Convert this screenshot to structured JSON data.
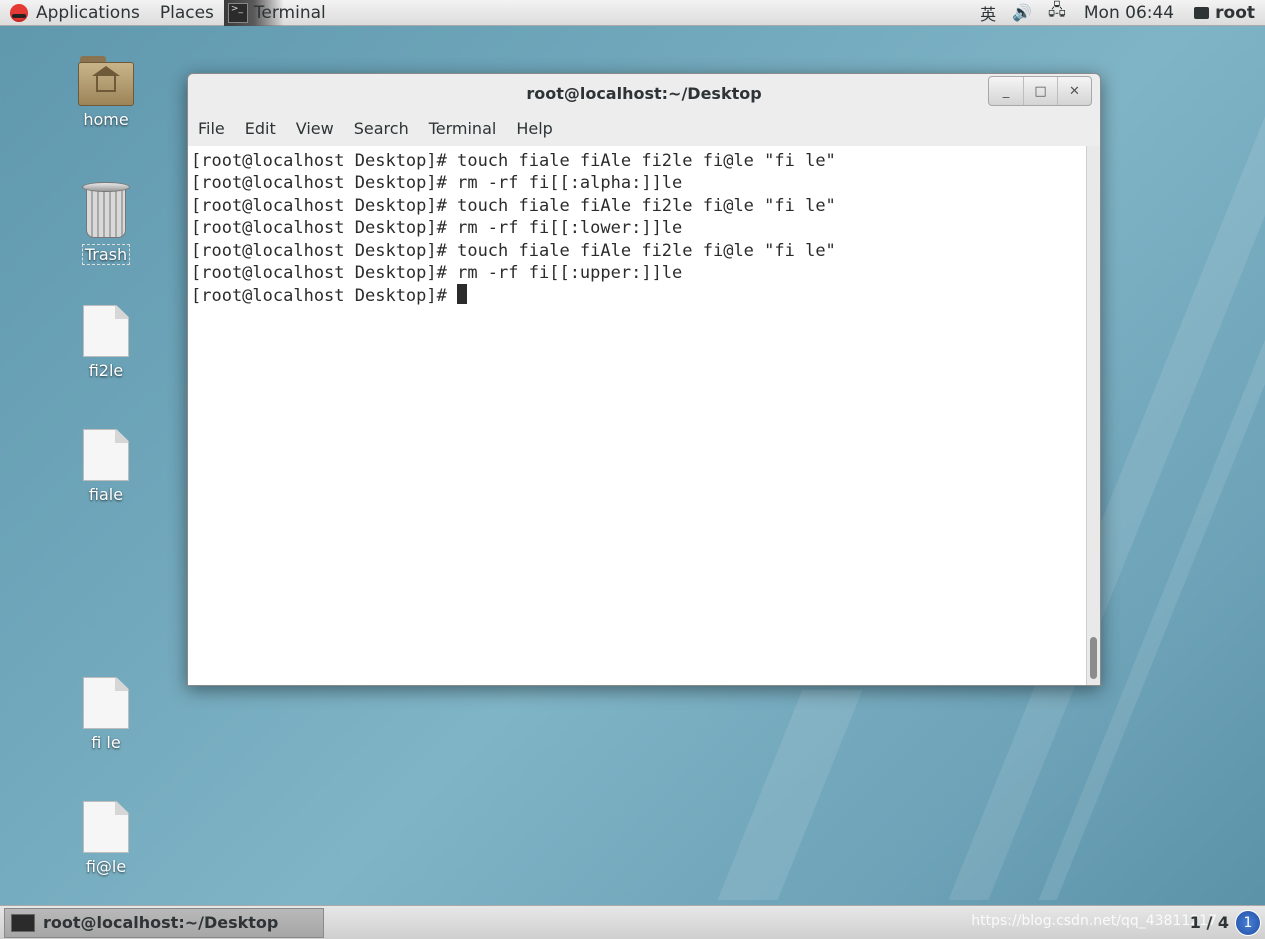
{
  "top_panel": {
    "applications_label": "Applications",
    "places_label": "Places",
    "active_task_label": "Terminal",
    "input_method_label": "英",
    "clock": "Mon 06:44",
    "user_label": "root"
  },
  "desktop": {
    "icons": [
      {
        "label": "home",
        "type": "folder"
      },
      {
        "label": "Trash",
        "type": "trash"
      },
      {
        "label": "fi2le",
        "type": "file"
      },
      {
        "label": "fiale",
        "type": "file"
      },
      {
        "label": "fi le",
        "type": "file"
      },
      {
        "label": "fi@le",
        "type": "file"
      }
    ]
  },
  "window": {
    "title": "root@localhost:~/Desktop",
    "controls": {
      "minimize": "_",
      "maximize": "□",
      "close": "✕"
    },
    "menu": [
      "File",
      "Edit",
      "View",
      "Search",
      "Terminal",
      "Help"
    ],
    "lines": [
      "[root@localhost Desktop]# touch fiale fiAle fi2le fi@le \"fi le\"",
      "[root@localhost Desktop]# rm -rf fi[[:alpha:]]le",
      "[root@localhost Desktop]# touch fiale fiAle fi2le fi@le \"fi le\"",
      "[root@localhost Desktop]# rm -rf fi[[:lower:]]le",
      "[root@localhost Desktop]# touch fiale fiAle fi2le fi@le \"fi le\"",
      "[root@localhost Desktop]# rm -rf fi[[:upper:]]le"
    ],
    "prompt": "[root@localhost Desktop]# "
  },
  "bottom_panel": {
    "task_label": "root@localhost:~/Desktop",
    "watermark": "https://blog.csdn.net/qq_43811217",
    "workspace": "1 / 4",
    "notify_label": "1"
  }
}
